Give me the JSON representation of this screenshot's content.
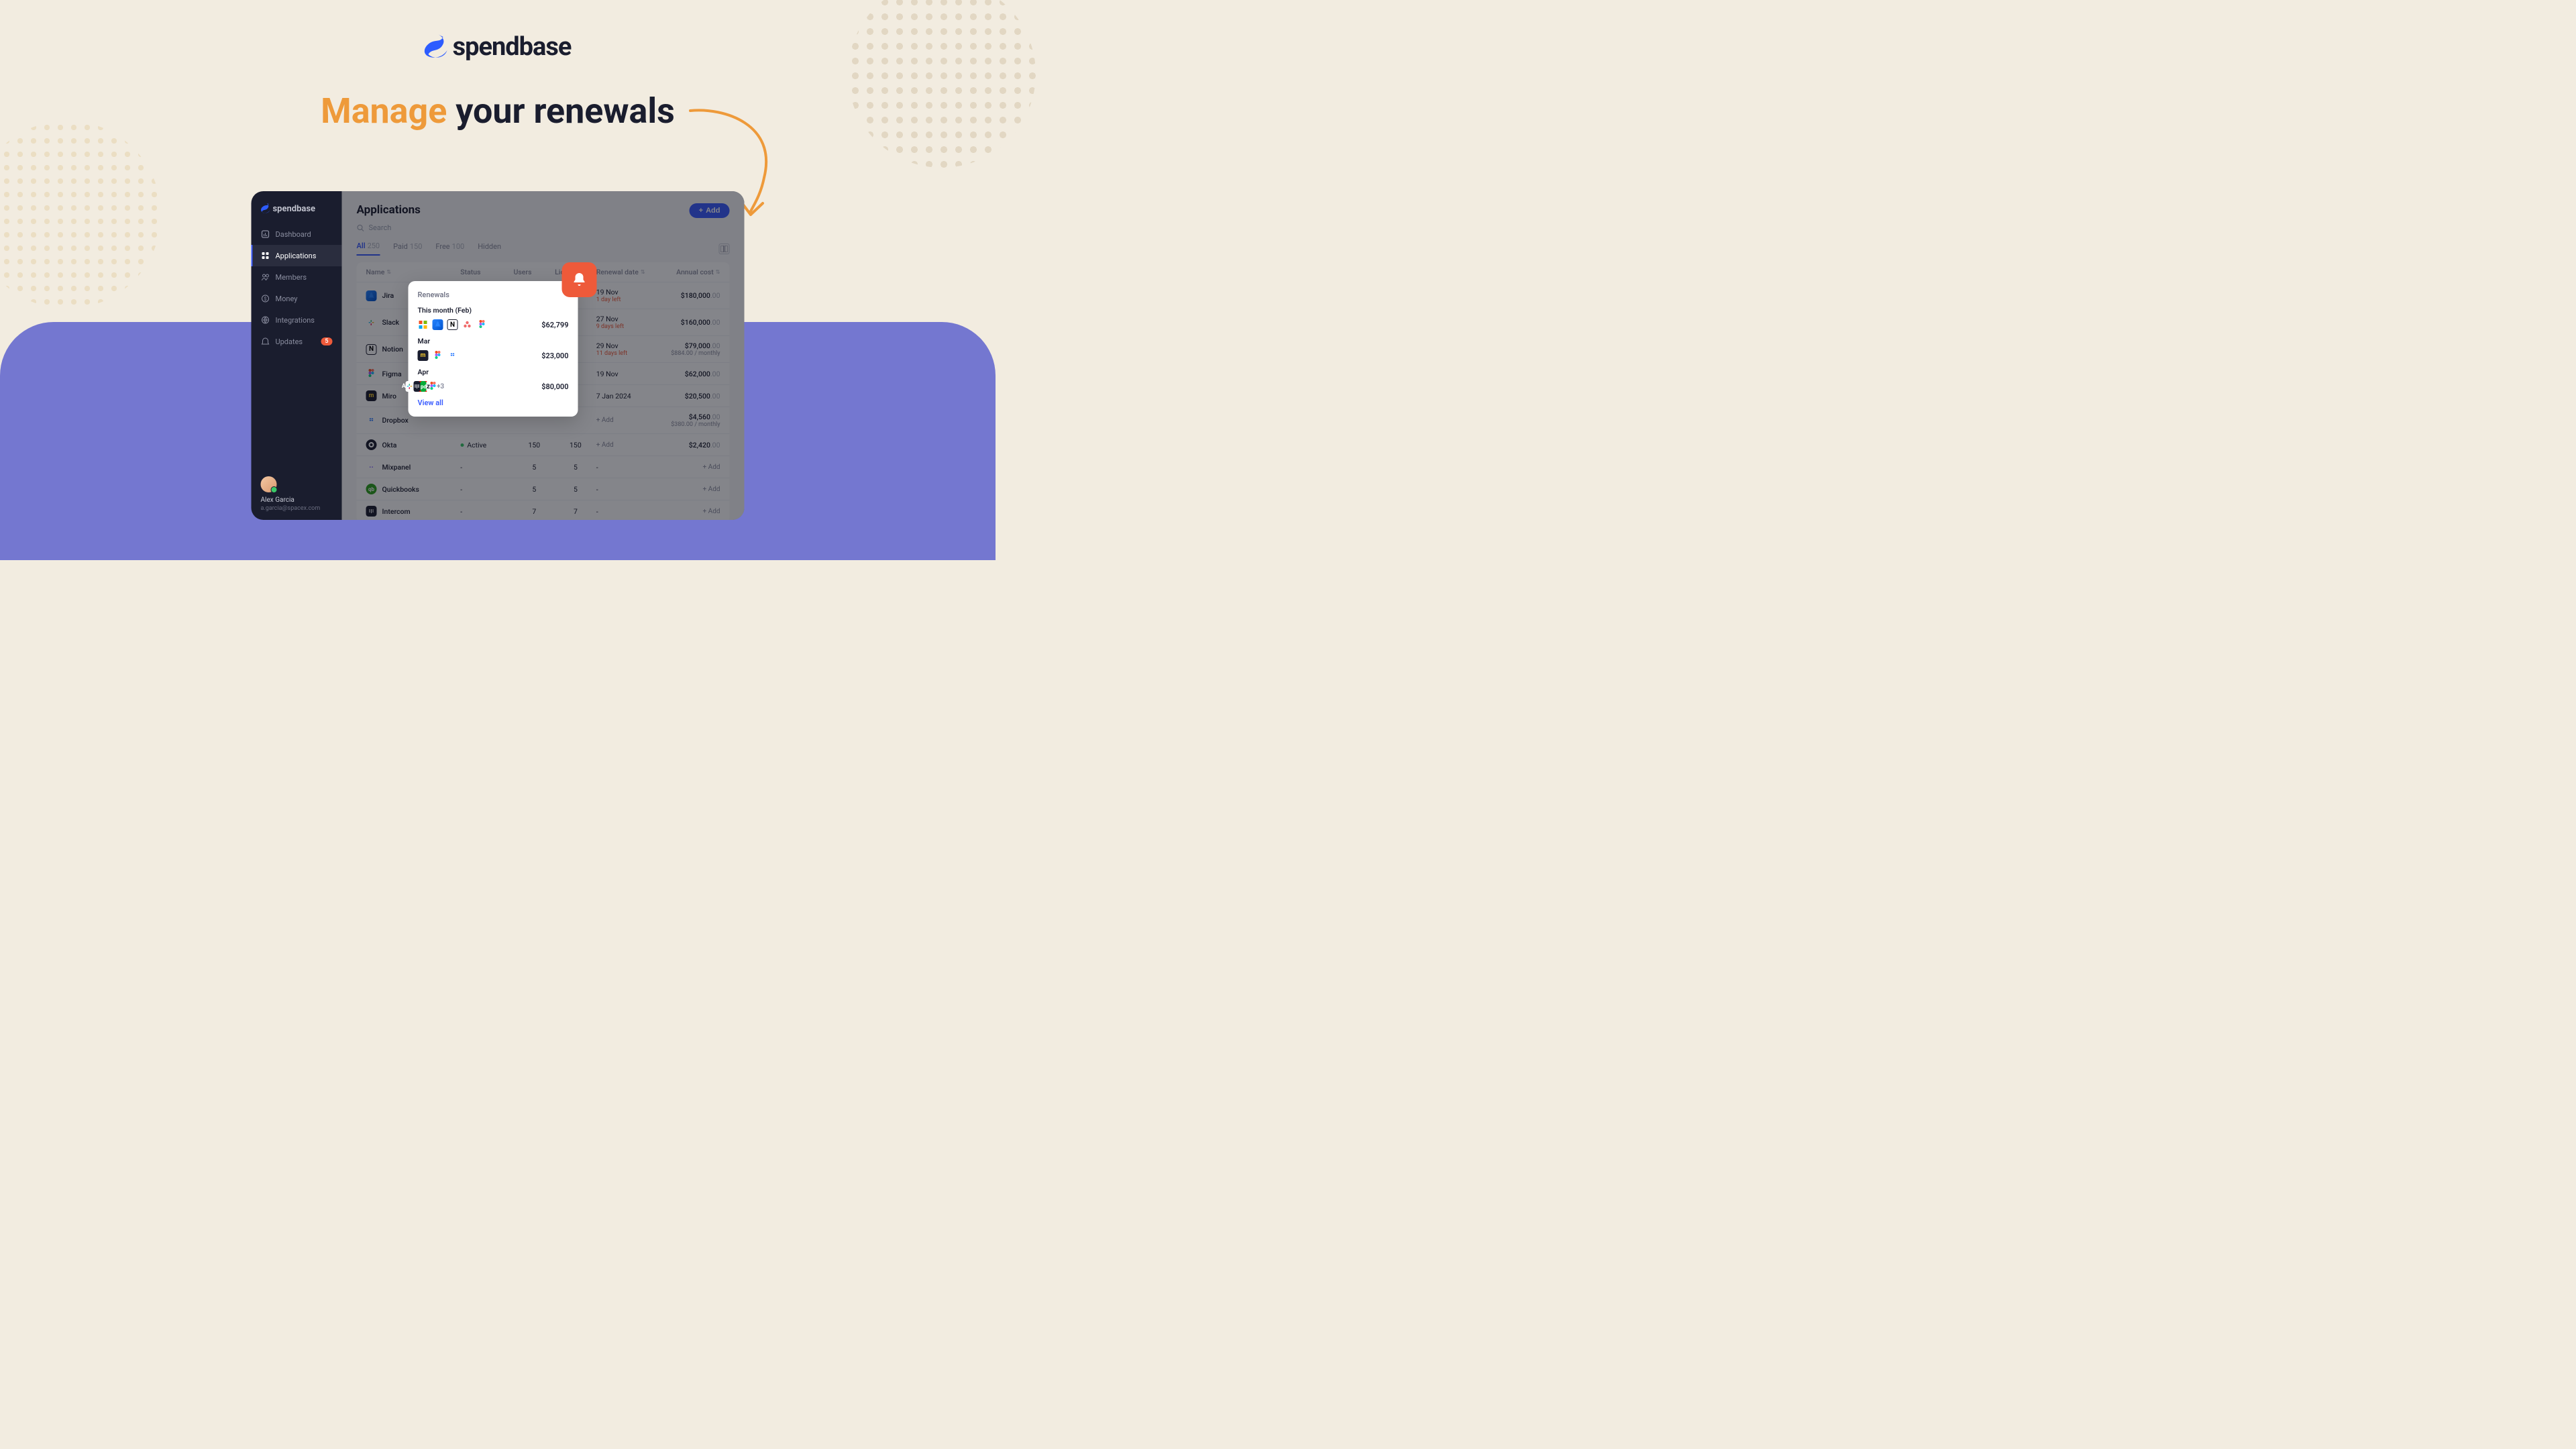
{
  "brand": {
    "name": "spendbase"
  },
  "headline": {
    "accent": "Manage",
    "rest": " your renewals"
  },
  "sidebar": {
    "items": [
      {
        "key": "dashboard",
        "label": "Dashboard"
      },
      {
        "key": "applications",
        "label": "Applications",
        "active": true
      },
      {
        "key": "members",
        "label": "Members"
      },
      {
        "key": "money",
        "label": "Money"
      },
      {
        "key": "integrations",
        "label": "Integrations"
      },
      {
        "key": "updates",
        "label": "Updates",
        "badge": "5"
      }
    ],
    "user": {
      "name": "Alex Garcia",
      "email": "a.garcia@spacex.com"
    }
  },
  "page": {
    "title": "Applications",
    "add_btn": "Add",
    "search_placeholder": "Search",
    "tabs": [
      {
        "label": "All",
        "count": "250",
        "active": true
      },
      {
        "label": "Paid",
        "count": "150"
      },
      {
        "label": "Free",
        "count": "100"
      },
      {
        "label": "Hidden"
      }
    ],
    "columns": [
      "Name",
      "Status",
      "Users",
      "Licenses",
      "Renewal date",
      "Annual cost"
    ],
    "rows": [
      {
        "app": "Jira",
        "ic": "jira",
        "status": "",
        "users": "",
        "licenses": "",
        "renew": "19 Nov",
        "renew_sub": "1 day left",
        "cost": "$180,000",
        "cents": ".00"
      },
      {
        "app": "Slack",
        "ic": "slack",
        "status": "",
        "users": "",
        "licenses": "",
        "renew": "27 Nov",
        "renew_sub": "9 days left",
        "cost": "$160,000",
        "cents": ".00"
      },
      {
        "app": "Notion",
        "ic": "notion",
        "status": "",
        "users": "",
        "licenses": "",
        "renew": "29 Nov",
        "renew_sub": "11 days left",
        "cost": "$79,000",
        "cents": ".00",
        "cost_sub": "$884.00 / monthly"
      },
      {
        "app": "Figma",
        "ic": "figma",
        "status": "",
        "users": "",
        "licenses": "",
        "renew": "19 Nov",
        "cost": "$62,000",
        "cents": ".00"
      },
      {
        "app": "Miro",
        "ic": "miro",
        "status": "",
        "users": "",
        "licenses": "",
        "renew": "7 Jan 2024",
        "cost": "$20,500",
        "cents": ".00"
      },
      {
        "app": "Dropbox",
        "ic": "dropbox",
        "status": "",
        "users": "",
        "licenses": "",
        "renew_add": "+ Add",
        "cost": "$4,560",
        "cents": ".00",
        "cost_sub": "$380.00 / monthly"
      },
      {
        "app": "Okta",
        "ic": "okta",
        "status": "Active",
        "users": "150",
        "licenses": "150",
        "renew_add": "+ Add",
        "cost": "$2,420",
        "cents": ".00"
      },
      {
        "app": "Mixpanel",
        "ic": "mixpanel",
        "status": "-",
        "users": "5",
        "licenses": "5",
        "renew": "-",
        "cost_add": "+ Add"
      },
      {
        "app": "Quickbooks",
        "ic": "qb",
        "status": "-",
        "users": "5",
        "licenses": "5",
        "renew": "-",
        "cost_add": "+ Add"
      },
      {
        "app": "Intercom",
        "ic": "intercom",
        "status": "-",
        "users": "7",
        "licenses": "7",
        "renew": "-",
        "cost_add": "+ Add"
      }
    ]
  },
  "popup": {
    "title": "Renewals",
    "groups": [
      {
        "month": "This month (Feb)",
        "icons": [
          "ms",
          "jira",
          "notion",
          "asana",
          "figma"
        ],
        "amount": "$62,799"
      },
      {
        "month": "Mar",
        "icons": [
          "miro",
          "figma",
          "dropbox"
        ],
        "amount": "$23,000"
      },
      {
        "month": "Apr",
        "icons": [
          "adobe",
          "slack",
          "intercom",
          "pd",
          "hub",
          "zendesk",
          "figma"
        ],
        "more": "+3",
        "amount": "$80,000"
      }
    ],
    "view_all": "View all"
  }
}
